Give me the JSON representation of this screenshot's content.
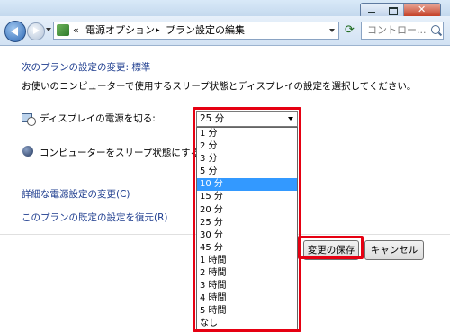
{
  "address_bar": {
    "prefix": "«",
    "path": [
      "電源オプション",
      "プラン設定の編集"
    ],
    "separator": "▸"
  },
  "search": {
    "placeholder": "コントロー..."
  },
  "heading": "次のプランの設定の変更: 標準",
  "description": "お使いのコンピューターで使用するスリープ状態とディスプレイの設定を選択してください。",
  "settings": {
    "display_off_label": "ディスプレイの電源を切る:",
    "sleep_label": "コンピューターをスリープ状態にする:"
  },
  "dropdown": {
    "selected": "25 分",
    "options": [
      "1 分",
      "2 分",
      "3 分",
      "5 分",
      "10 分",
      "15 分",
      "20 分",
      "25 分",
      "30 分",
      "45 分",
      "1 時間",
      "2 時間",
      "3 時間",
      "4 時間",
      "5 時間",
      "なし"
    ],
    "highlighted_option": "10 分"
  },
  "links": {
    "advanced": "詳細な電源設定の変更(C)",
    "restore": "このプランの既定の設定を復元(R)"
  },
  "buttons": {
    "save": "変更の保存",
    "cancel": "キャンセル"
  },
  "colors": {
    "highlight_frame": "#e60012",
    "link": "#1e3d8f",
    "selection": "#3399ff"
  }
}
